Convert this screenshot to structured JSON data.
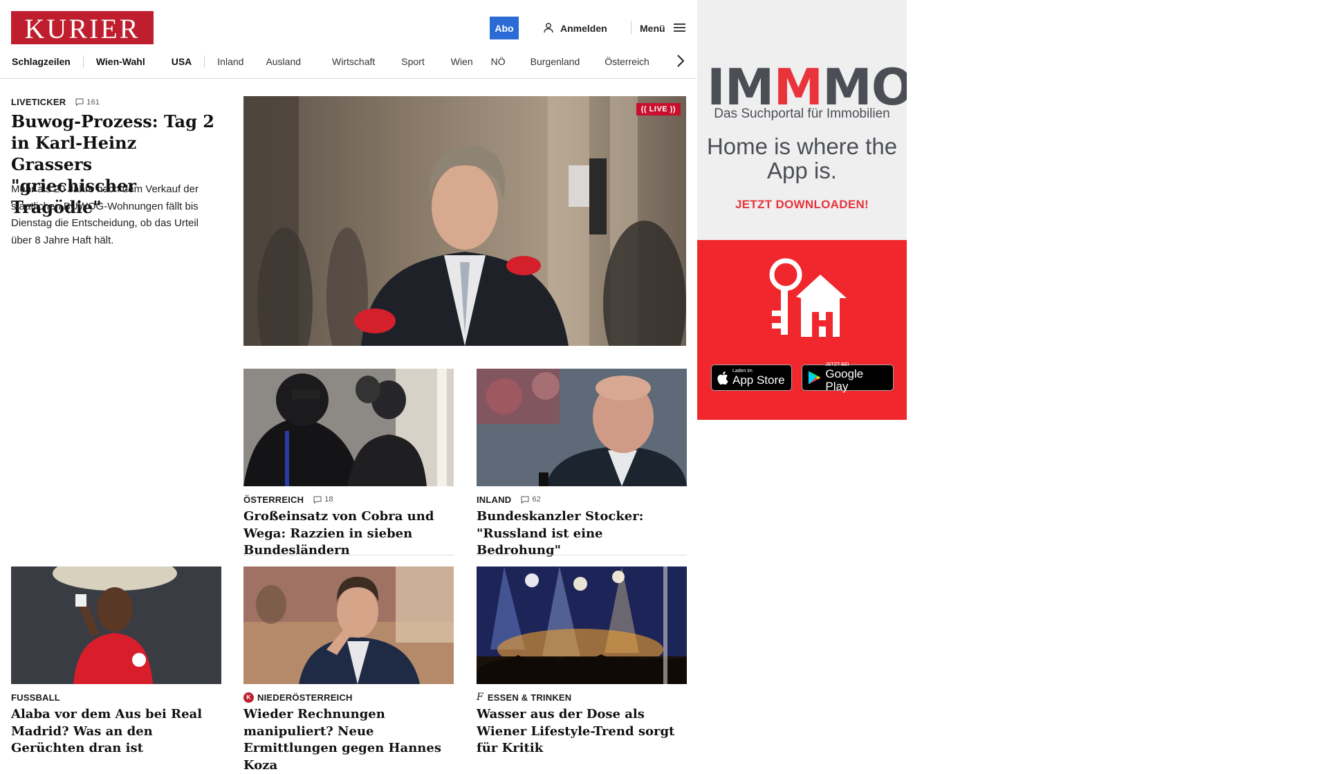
{
  "header": {
    "logo_text": "KURIER",
    "abo_label": "Abo",
    "login_label": "Anmelden",
    "menu_label": "Menü",
    "brand_color": "#bf1e2e",
    "abo_color": "#2a6bd6"
  },
  "nav": {
    "items": [
      "Schlagzeilen",
      "Wien-Wahl",
      "USA",
      "Inland",
      "Ausland",
      "Wirtschaft",
      "Sport",
      "Wien",
      "NÖ",
      "Burgenland",
      "Österreich"
    ]
  },
  "lead": {
    "kicker": "LIVETICKER",
    "comments": "161",
    "title": "Buwog-Prozess: Tag 2 in Karl-Heinz Grassers \"griechischer Tragödie\"",
    "teaser": "Mehr als 20 Jahre nach dem Verkauf der staatlichen BUWOG-Wohnungen fällt bis Dienstag die Entscheidung, ob das Urteil über 8 Jahre Haft hält.",
    "live_badge": "(( LIVE ))"
  },
  "cards": [
    {
      "kicker": "ÖSTERREICH",
      "comments": "18",
      "title": "Großeinsatz von Cobra und Wega: Razzien in sieben Bundesländern"
    },
    {
      "kicker": "INLAND",
      "comments": "62",
      "title": "Bundeskanzler Stocker: \"Russland ist eine Bedrohung\""
    },
    {
      "kicker": "FUSSBALL",
      "title": "Alaba vor dem Aus bei Real Madrid? Was an den Gerüchten dran ist"
    },
    {
      "kicker": "NIEDERÖSTERREICH",
      "topic_icon": "K",
      "title": "Wieder Rechnungen manipuliert? Neue Ermittlungen gegen Hannes Koza"
    },
    {
      "kicker": "ESSEN & TRINKEN",
      "topic_icon": "f",
      "title": "Wasser aus der Dose als Wiener Lifestyle-Trend sorgt für Kritik"
    }
  ],
  "ad": {
    "logo_part1": "IM",
    "logo_part2": "M",
    "logo_part3": "MO",
    "subtitle": "Das Suchportal für Immobilien",
    "claim": "Home is where the App is.",
    "cta": "JETZT DOWNLOADEN!",
    "appstore_small": "Laden im",
    "appstore_big": "App Store",
    "googleplay_small": "JETZT BEI",
    "googleplay_big": "Google Play",
    "accent_color": "#e8333a"
  },
  "icons": [
    "user-icon",
    "hamburger-icon",
    "chevron-right-icon",
    "comment-icon",
    "apple-icon",
    "google-play-icon",
    "keys-house-icon"
  ]
}
